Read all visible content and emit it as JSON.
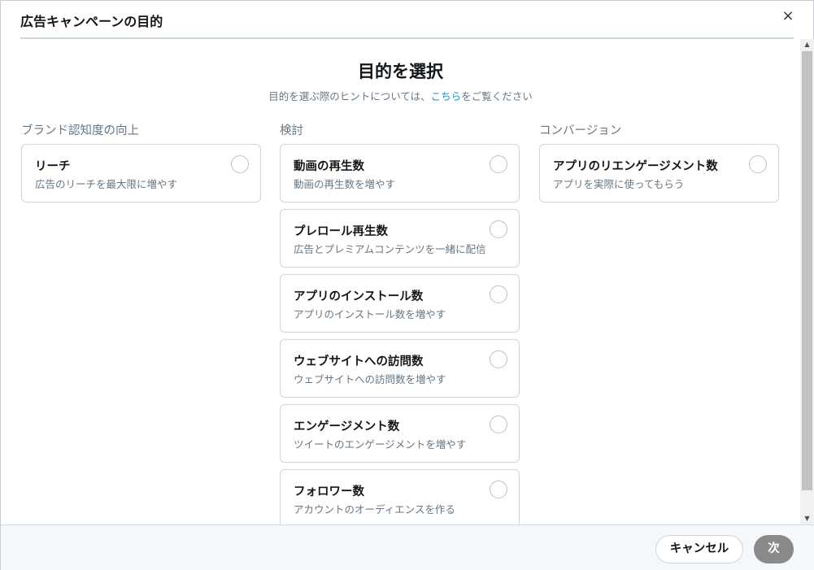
{
  "dialog": {
    "title": "広告キャンペーンの目的",
    "close_icon": "×"
  },
  "main": {
    "title": "目的を選択",
    "subtitle_before": "目的を選ぶ際のヒントについては、",
    "subtitle_link": "こちら",
    "subtitle_after": "をご覧ください"
  },
  "columns": [
    {
      "heading": "ブランド認知度の向上",
      "cards": [
        {
          "title": "リーチ",
          "desc": "広告のリーチを最大限に増やす"
        }
      ]
    },
    {
      "heading": "検討",
      "cards": [
        {
          "title": "動画の再生数",
          "desc": "動画の再生数を増やす"
        },
        {
          "title": "プレロール再生数",
          "desc": "広告とプレミアムコンテンツを一緒に配信"
        },
        {
          "title": "アプリのインストール数",
          "desc": "アプリのインストール数を増やす"
        },
        {
          "title": "ウェブサイトへの訪問数",
          "desc": "ウェブサイトへの訪問数を増やす"
        },
        {
          "title": "エンゲージメント数",
          "desc": "ツイートのエンゲージメントを増やす"
        },
        {
          "title": "フォロワー数",
          "desc": "アカウントのオーディエンスを作る"
        }
      ]
    },
    {
      "heading": "コンバージョン",
      "cards": [
        {
          "title": "アプリのリエンゲージメント数",
          "desc": "アプリを実際に使ってもらう"
        }
      ]
    }
  ],
  "footer": {
    "cancel_label": "キャンセル",
    "next_label": "次"
  },
  "colors": {
    "link": "#1b95e0",
    "next_button_disabled": "#8a8a8a"
  }
}
